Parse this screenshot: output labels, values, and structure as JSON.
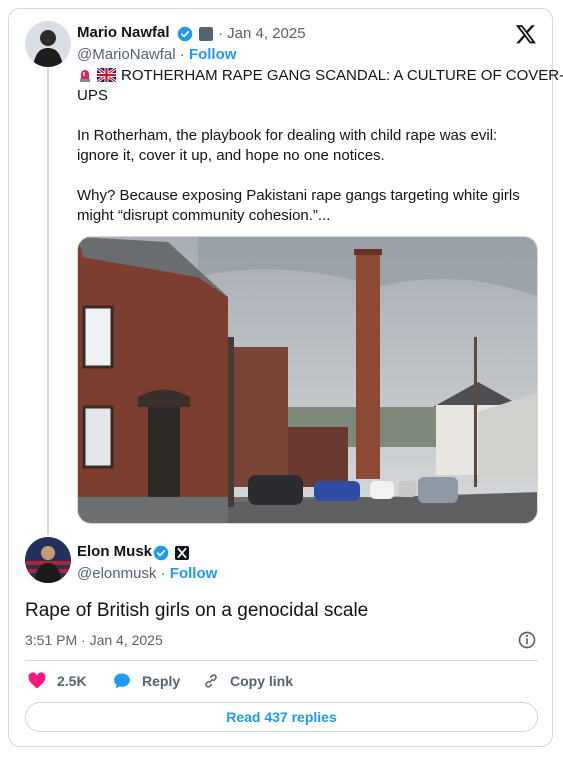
{
  "quoted": {
    "author_name": "Mario Nawfal",
    "handle": "@MarioNawfal",
    "separator": "·",
    "follow_label": "Follow",
    "date": "· Jan 4, 2025",
    "headline_line1": "ROTHERHAM RAPE GANG SCANDAL: A CULTURE OF COVER-",
    "headline_line2": "UPS",
    "para1_line1": "In Rotherham, the playbook for dealing with child rape was evil:",
    "para1_line2": "ignore it, cover it up, and hope no one notices.",
    "para2_line1": "Why? Because exposing Pakistani rape gangs targeting white girls",
    "para2_line2": "might “disrupt community cohesion.”..."
  },
  "main": {
    "author_name": "Elon Musk",
    "handle": "@elonmusk",
    "separator": "·",
    "follow_label": "Follow",
    "text": "Rape of British girls on a genocidal scale",
    "timestamp": "3:51 PM · Jan 4, 2025"
  },
  "actions": {
    "likes": "2.5K",
    "reply_label": "Reply",
    "copy_label": "Copy link",
    "read_replies": "Read 437 replies"
  },
  "icons": {
    "verified": "verified-badge-icon",
    "x_logo": "x-logo-icon",
    "like": "heart-icon",
    "reply": "reply-bubble-icon",
    "copy": "link-icon",
    "info": "info-icon"
  },
  "colors": {
    "accent": "#1d9bf0",
    "like": "#f91880",
    "muted": "#536471",
    "border": "#cfd9de"
  }
}
